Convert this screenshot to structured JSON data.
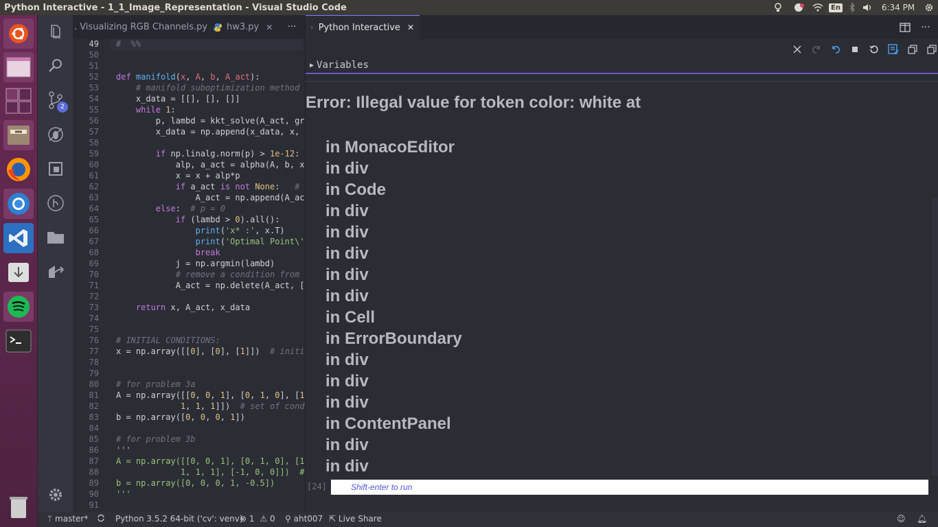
{
  "window": {
    "title": "Python Interactive - 1_1_Image_Representation - Visual Studio Code"
  },
  "tray": {
    "keyboard_layout": "En",
    "clock": "6:34 PM"
  },
  "launcher": {
    "items": [
      {
        "name": "ubuntu-dash-icon"
      },
      {
        "name": "workspace-icon"
      },
      {
        "name": "workspace-switcher-icon"
      },
      {
        "name": "files-icon"
      },
      {
        "name": "firefox-icon"
      },
      {
        "name": "chromium-icon"
      },
      {
        "name": "vscode-icon"
      },
      {
        "name": "installer-icon"
      },
      {
        "name": "spotify-icon"
      },
      {
        "name": "terminal-icon"
      },
      {
        "name": "trash-icon"
      }
    ]
  },
  "activitybar": {
    "scm_badge": "2"
  },
  "tabs_left": [
    {
      "label": ". Visualizing RGB Channels.py"
    },
    {
      "label": "hw3.py",
      "close": "✕"
    },
    {
      "label": "···"
    }
  ],
  "tab_right": {
    "label": "Python Interactive",
    "close": "✕"
  },
  "code": {
    "line_numbers": [
      "49",
      "50",
      "51",
      "52",
      "53",
      "54",
      "55",
      "56",
      "57",
      "58",
      "59",
      "60",
      "61",
      "62",
      "63",
      "64",
      "65",
      "66",
      "67",
      "68",
      "69",
      "70",
      "71",
      "72",
      "73",
      "74",
      "75",
      "76",
      "77",
      "78",
      "79",
      "80",
      "81",
      "82",
      "83",
      "84",
      "85",
      "86",
      "87",
      "88",
      "89",
      "90",
      "91"
    ]
  },
  "variables": {
    "label": "Variables"
  },
  "error": {
    "title": "Error: Illegal value for token color: white at",
    "stack": [
      "in MonacoEditor",
      "in div",
      "in Code",
      "in div",
      "in div",
      "in div",
      "in div",
      "in div",
      "in Cell",
      "in ErrorBoundary",
      "in div",
      "in div",
      "in div",
      "in ContentPanel",
      "in div",
      "in div"
    ]
  },
  "input": {
    "execution_count": "[24]",
    "placeholder": "Shift-enter to run"
  },
  "statusbar": {
    "branch": "master*",
    "interpreter": "Python 3.5.2 64-bit ('cv': venv)",
    "errors": "1",
    "warnings": "0",
    "user": "aht007",
    "live_share": "Live Share"
  },
  "colors": {
    "accent": "#6a56c7",
    "launcher": "#5b2649",
    "editor_bg": "#2b2d35"
  }
}
